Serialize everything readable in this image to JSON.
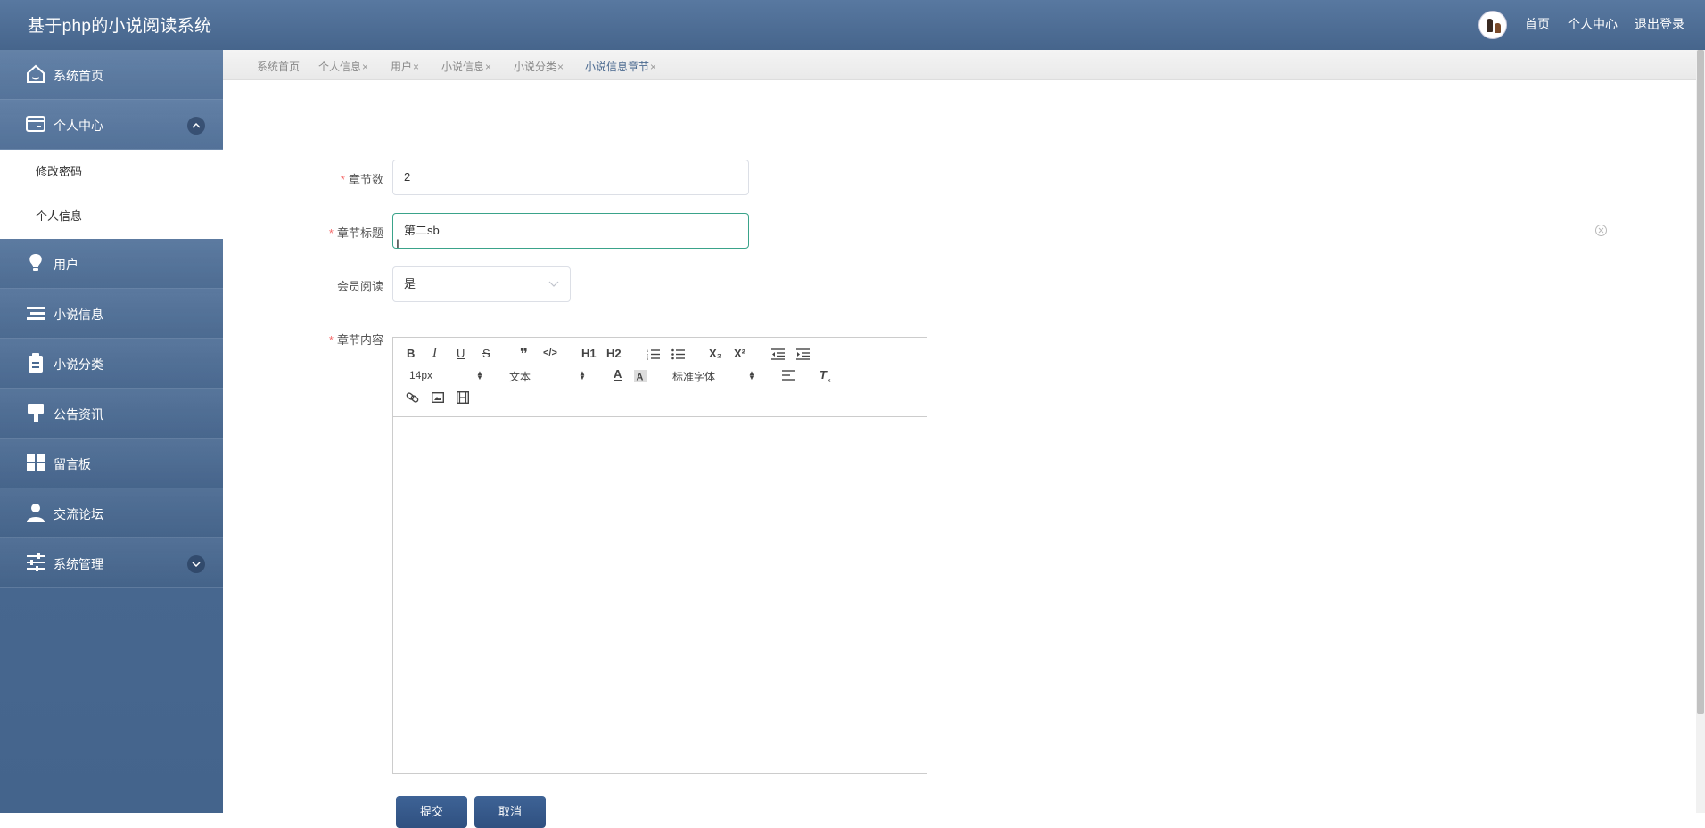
{
  "header": {
    "title": "基于php的小说阅读系统",
    "nav": [
      "首页",
      "个人中心",
      "退出登录"
    ]
  },
  "sidebar": {
    "items": [
      {
        "label": "系统首页",
        "icon": "home-icon"
      },
      {
        "label": "个人中心",
        "icon": "card-icon",
        "expanded": true,
        "children": [
          "修改密码",
          "个人信息"
        ]
      },
      {
        "label": "用户",
        "icon": "bulb-icon"
      },
      {
        "label": "小说信息",
        "icon": "list-icon"
      },
      {
        "label": "小说分类",
        "icon": "clipboard-icon"
      },
      {
        "label": "公告资讯",
        "icon": "brush-icon"
      },
      {
        "label": "留言板",
        "icon": "grid-icon"
      },
      {
        "label": "交流论坛",
        "icon": "person-icon"
      },
      {
        "label": "系统管理",
        "icon": "sliders-icon",
        "expanded": false
      }
    ]
  },
  "tabs": [
    {
      "label": "系统首页",
      "closable": false
    },
    {
      "label": "个人信息",
      "closable": true
    },
    {
      "label": "用户",
      "closable": true
    },
    {
      "label": "小说信息",
      "closable": true
    },
    {
      "label": "小说分类",
      "closable": true
    },
    {
      "label": "小说信息章节",
      "closable": true,
      "active": true
    }
  ],
  "tab_close_glyph": "×",
  "form": {
    "chapter_number": {
      "label": "章节数",
      "value": "2",
      "required": true
    },
    "chapter_title": {
      "label": "章节标题",
      "value": "第二sb",
      "required": true
    },
    "vip_read": {
      "label": "会员阅读",
      "value": "是",
      "required": false
    },
    "chapter_content": {
      "label": "章节内容",
      "required": true,
      "value": ""
    }
  },
  "editor": {
    "font_size": "14px",
    "header_select": "文本",
    "font_family": "标准字体",
    "buttons": [
      "B",
      "I",
      "U",
      "S",
      "❞",
      "</>",
      "H1",
      "H2",
      "ordered-list",
      "bullet-list",
      "X₂",
      "X²",
      "outdent",
      "indent",
      "A",
      "background-color",
      "align",
      "clear-format",
      "link",
      "image",
      "video"
    ]
  },
  "actions": {
    "submit": "提交",
    "cancel": "取消"
  },
  "colors": {
    "header_bg": "#4f6f97",
    "sidebar_bg": "#4a6a92",
    "focus_border": "#3aa38a",
    "required": "#f56c6c",
    "button_bg": "#36588a"
  }
}
